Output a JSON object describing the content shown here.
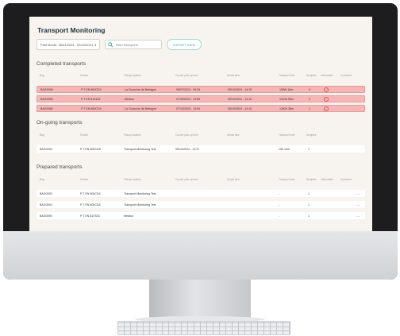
{
  "app": {
    "title": "Transport Monitoring",
    "date_range": "Past Month: 08/01/2024 - 09/10/2024",
    "search_placeholder": "Filter transports",
    "export_label": "EXPORT DATA"
  },
  "columns": [
    "Bag",
    "Sender",
    "Pickup location",
    "Courier pick-up time",
    "Arrival time",
    "Transport time",
    "Samples",
    "Information",
    "Comment"
  ],
  "completed": {
    "title": "Completed transports",
    "rows": [
      {
        "bag": "BAG0045",
        "sender": "P T EN 800CD4",
        "pickup": "La Guanche de Bretagne",
        "pickup_time": "08/27/2024 - 09:26",
        "arrival": "09/10/2024 - 14:15",
        "transport": "10Wh 16m",
        "samples": "4"
      },
      {
        "bag": "BAG0050",
        "sender": "P T EN 814103",
        "pickup": "Medica",
        "pickup_time": "07/30/2024 - 13:59",
        "arrival": "09/10/2024 - 14:15",
        "transport": "1344h 55m",
        "samples": "3"
      },
      {
        "bag": "BAG0060",
        "sender": "P T EN 800CD4",
        "pickup": "La Guanche de Bretagne",
        "pickup_time": "07/10/2024 - 13:54",
        "arrival": "09/10/2024 - 14:15",
        "transport": "1282h 38m",
        "samples": "1"
      }
    ]
  },
  "ongoing": {
    "title": "On-going transports",
    "rows": [
      {
        "bag": "BAG0094",
        "sender": "P T EN 800CD8",
        "pickup": "Transport Monitoring Test",
        "pickup_time": "09/10/2024 - 13:37",
        "arrival": "",
        "transport": "19h 13m",
        "samples": "1"
      }
    ]
  },
  "prepared": {
    "title": "Prepared transports",
    "rows": [
      {
        "bag": "BAG0093",
        "sender": "P T EN 800CD4",
        "pickup": "Transport Monitoring Test",
        "transport": "-",
        "samples": "1",
        "comment": "..."
      },
      {
        "bag": "BAG0092",
        "sender": "P T EN 800CD4",
        "pickup": "Transport Monitoring Test",
        "transport": "-",
        "samples": "1",
        "comment": "..."
      },
      {
        "bag": "BAG0090",
        "sender": "P T EN 814TAC",
        "pickup": "Medica",
        "transport": "-",
        "samples": "1",
        "comment": "..."
      }
    ]
  },
  "colors": {
    "error_row": "#f5b6b5",
    "accent": "#3aa6a3",
    "warning": "#d9534f"
  }
}
